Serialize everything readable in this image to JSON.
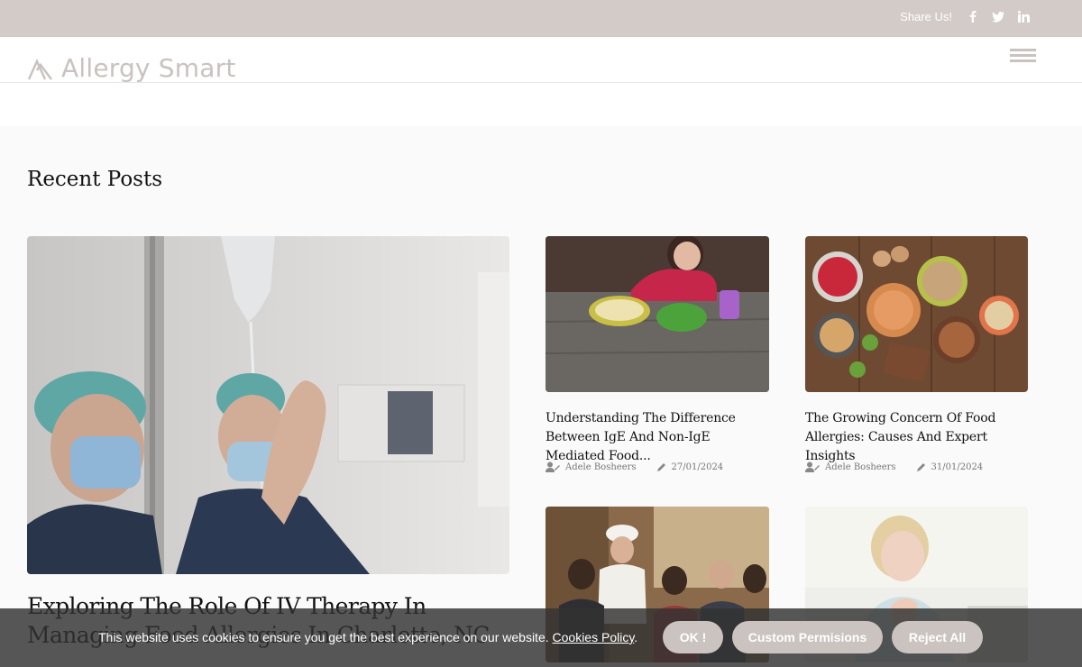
{
  "topbar": {
    "share_label": "Share Us!",
    "icons": [
      "facebook-icon",
      "twitter-icon",
      "linkedin-icon"
    ]
  },
  "brand": {
    "name": "Allergy Smart"
  },
  "section": {
    "title": "Recent Posts"
  },
  "featured": {
    "title": "Exploring The Role Of IV Therapy In Managing Food Allergies In Charlotte, NC"
  },
  "posts": [
    {
      "title": "Understanding The Difference Between IgE And Non-IgE Mediated Food...",
      "author": "Adele Bosheers",
      "date": "27/01/2024"
    },
    {
      "title": "The Growing Concern Of Food Allergies: Causes And Expert Insights",
      "author": "Adele Bosheers",
      "date": "31/01/2024"
    }
  ],
  "cookie": {
    "message": "This website uses cookies to ensure you get the best experience on our website.",
    "policy_link": "Cookies Policy",
    "ok_label": "OK !",
    "custom_label": "Custom Permisions",
    "reject_label": "Reject All"
  },
  "colors": {
    "topbar": "#d3cbc8",
    "logo": "#c9c2bf",
    "button": "#cbc3c0"
  }
}
